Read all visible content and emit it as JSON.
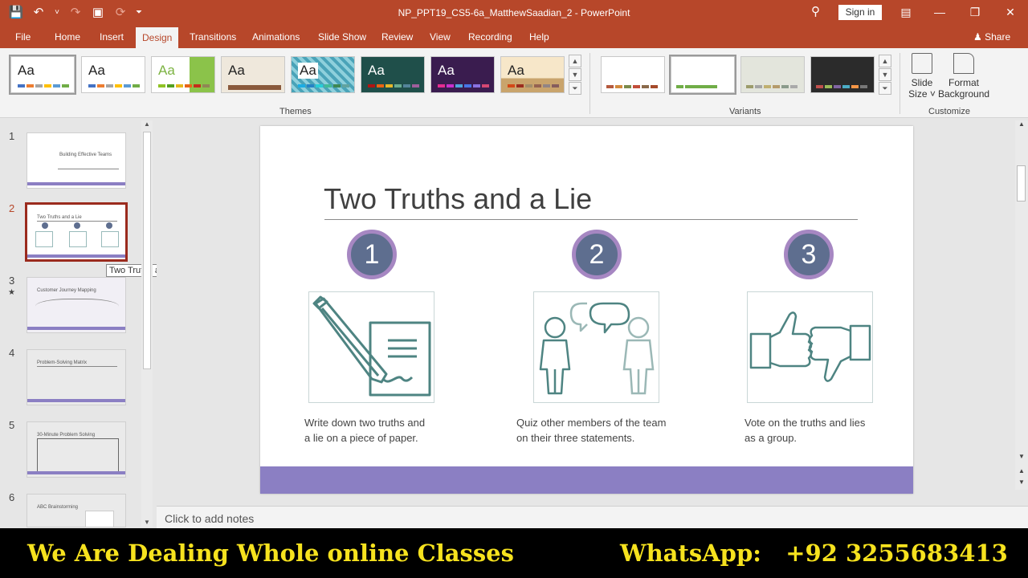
{
  "window": {
    "title": "NP_PPT19_CS5-6a_MatthewSaadian_2  -  PowerPoint",
    "signin": "Sign in",
    "titlebar_color": "#b7472a"
  },
  "tabs": [
    {
      "label": "File"
    },
    {
      "label": "Home"
    },
    {
      "label": "Insert"
    },
    {
      "label": "Design"
    },
    {
      "label": "Transitions"
    },
    {
      "label": "Animations"
    },
    {
      "label": "Slide Show"
    },
    {
      "label": "Review"
    },
    {
      "label": "View"
    },
    {
      "label": "Recording"
    },
    {
      "label": "Help"
    }
  ],
  "active_tab": "Design",
  "share_label": "Share",
  "ribbon": {
    "themes_label": "Themes",
    "variants_label": "Variants",
    "customize_label": "Customize",
    "theme_glyph": "Aa",
    "slide_size": {
      "line1": "Slide",
      "line2": "Size ˅"
    },
    "format_background": {
      "line1": "Format",
      "line2": "Background"
    }
  },
  "thumbnails": [
    {
      "num": "1",
      "title": "Building Effective Teams"
    },
    {
      "num": "2",
      "title": "Two Truths and a Lie"
    },
    {
      "num": "3",
      "title": "Customer Journey Mapping"
    },
    {
      "num": "4",
      "title": "Problem-Solving Matrix"
    },
    {
      "num": "5",
      "title": "30-Minute Problem Solving"
    },
    {
      "num": "6",
      "title": "ABC Brainstorming"
    }
  ],
  "tooltip": "Two Truths and a Lie",
  "slide": {
    "title": "Two Truths and a Lie",
    "steps": [
      {
        "number": "1",
        "caption_line1": "Write down two truths and",
        "caption_line2": "a lie on a piece of paper."
      },
      {
        "number": "2",
        "caption_line1": "Quiz other members of the team",
        "caption_line2": "on their three statements."
      },
      {
        "number": "3",
        "caption_line1": "Vote on the truths and lies",
        "caption_line2": "as a group."
      }
    ],
    "accent_color": "#8b7fc3",
    "circle_color": "#5e6e8f",
    "circle_border": "#a687c2",
    "icon_color": "#4e8482"
  },
  "notes_placeholder": "Click to add notes",
  "banner": {
    "left": "We Are Dealing Whole online Classes",
    "right": "WhatsApp:   +92 3255683413"
  }
}
